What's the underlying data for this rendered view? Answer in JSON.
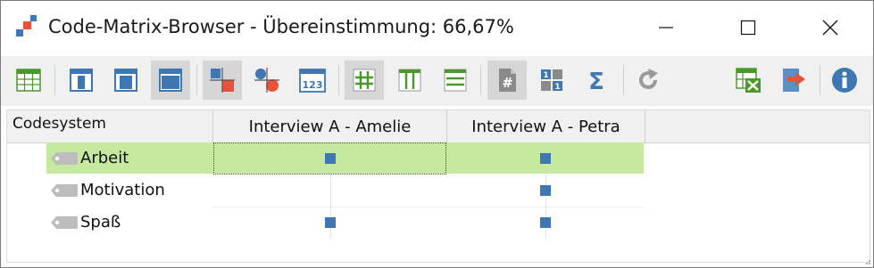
{
  "window": {
    "title": "Code-Matrix-Browser - Übereinstimmung: 66,67%",
    "app_icon": "code-matrix-app-icon",
    "controls": [
      "minimize-icon",
      "maximize-icon",
      "close-icon"
    ]
  },
  "toolbar": {
    "buttons": [
      {
        "icon": "table-grid-icon",
        "active": false
      },
      {
        "icon": "layout-narrow-columns-icon",
        "active": false
      },
      {
        "icon": "layout-medium-columns-icon",
        "active": false
      },
      {
        "icon": "layout-wide-columns-icon",
        "active": true
      },
      {
        "icon": "symbol-squares-icon",
        "active": true
      },
      {
        "icon": "symbol-circles-icon",
        "active": false
      },
      {
        "icon": "show-numbers-icon",
        "active": false
      },
      {
        "icon": "grid-lines-icon",
        "active": true
      },
      {
        "icon": "vertical-lines-icon",
        "active": false
      },
      {
        "icon": "horizontal-lines-icon",
        "active": false
      },
      {
        "icon": "document-hash-icon",
        "active": true
      },
      {
        "icon": "binary-matrix-icon",
        "active": false
      },
      {
        "icon": "sigma-icon",
        "active": false
      },
      {
        "icon": "refresh-icon",
        "active": false
      },
      {
        "icon": "excel-export-icon",
        "active": false
      },
      {
        "icon": "export-icon",
        "active": false
      },
      {
        "icon": "info-icon",
        "active": false
      }
    ]
  },
  "matrix": {
    "codesystem_header": "Codesystem",
    "columns": [
      "Interview A - Amelie",
      "Interview A - Petra"
    ],
    "rows": [
      {
        "label": "Arbeit",
        "highlighted": true,
        "cells": [
          true,
          true
        ]
      },
      {
        "label": "Motivation",
        "highlighted": false,
        "cells": [
          false,
          true
        ]
      },
      {
        "label": "Spaß",
        "highlighted": false,
        "cells": [
          true,
          true
        ]
      }
    ]
  },
  "colors": {
    "row_highlight": "#c5ea9f",
    "marker": "#3e77b3",
    "toolbar_blue": "#3e77b3",
    "toolbar_green": "#4a9a2a",
    "toolbar_red": "#e8523a",
    "tag_gray": "#bdbdbd"
  }
}
